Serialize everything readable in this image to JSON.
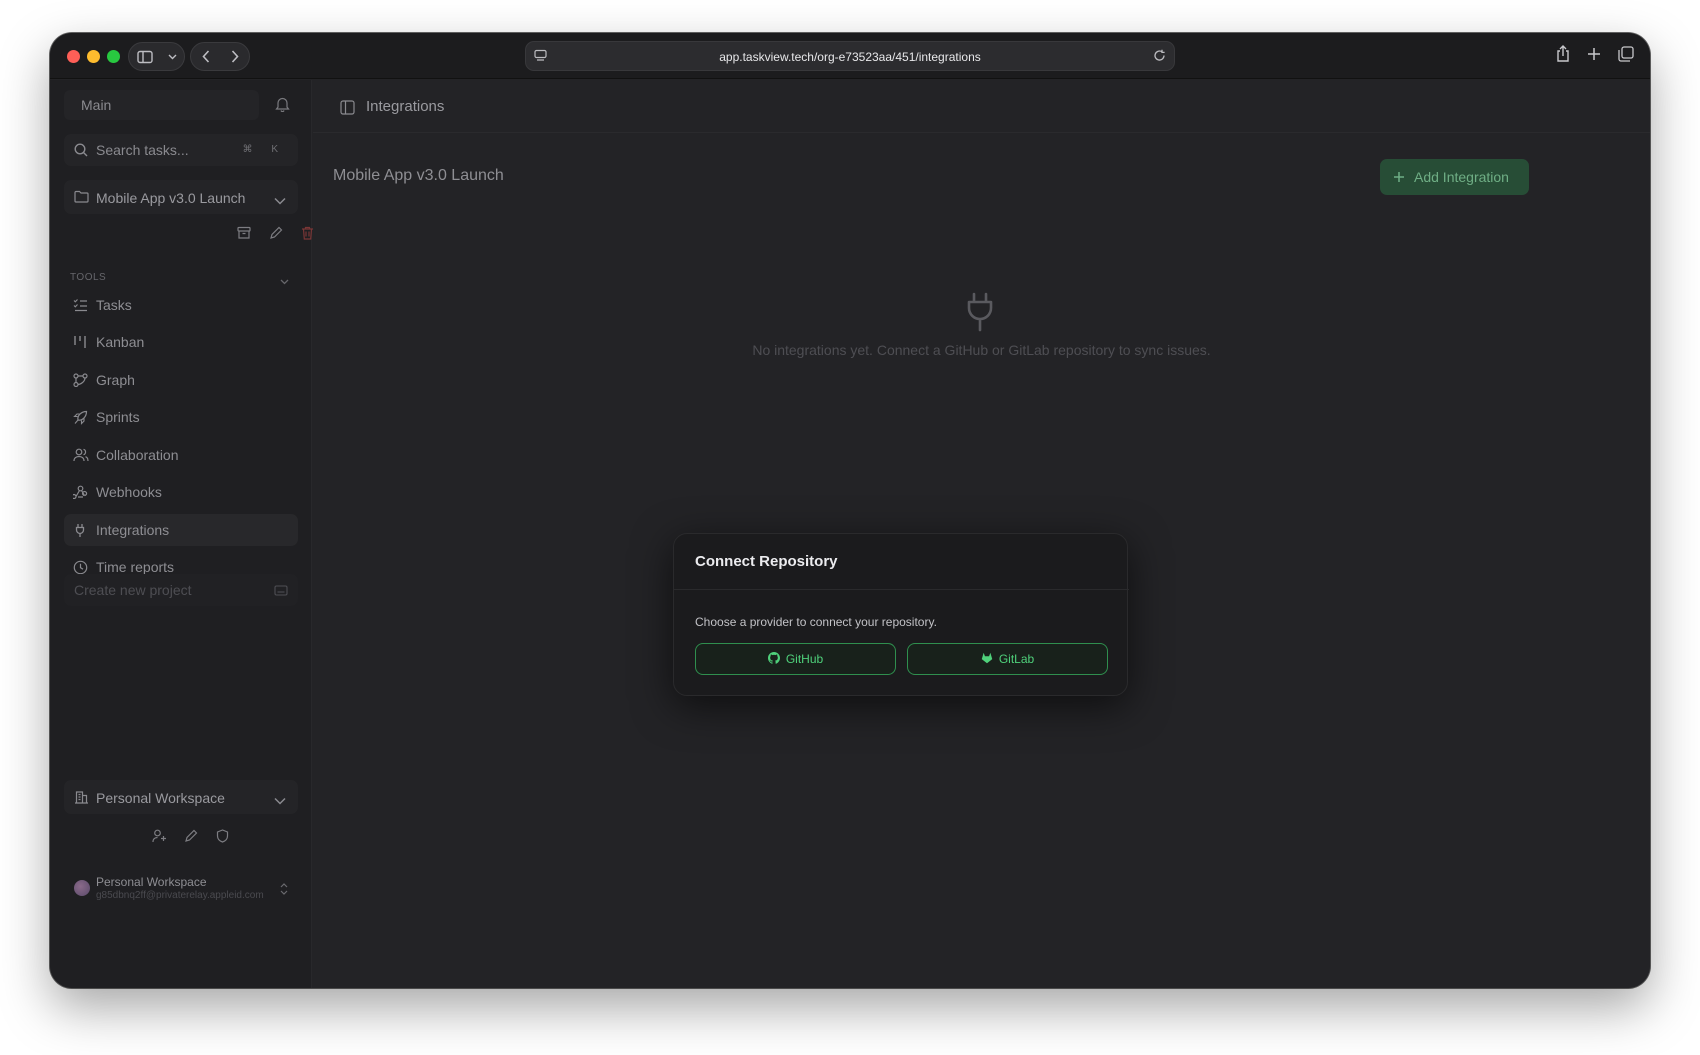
{
  "browser": {
    "url": "app.taskview.tech/org-e73523aa/451/integrations"
  },
  "sidebar": {
    "main_input": "Main",
    "search": {
      "placeholder": "Search tasks...",
      "shortcut": "⌘ K"
    },
    "project": "Mobile App v3.0 Launch",
    "tools_label": "TOOLS",
    "nav": [
      {
        "label": "Tasks",
        "icon": "tasks-icon"
      },
      {
        "label": "Kanban",
        "icon": "kanban-icon"
      },
      {
        "label": "Graph",
        "icon": "graph-icon"
      },
      {
        "label": "Sprints",
        "icon": "rocket-icon"
      },
      {
        "label": "Collaboration",
        "icon": "users-icon"
      },
      {
        "label": "Webhooks",
        "icon": "webhook-icon"
      },
      {
        "label": "Integrations",
        "icon": "plug-icon",
        "active": true
      },
      {
        "label": "Time reports",
        "icon": "clock-icon"
      }
    ],
    "create_project": "Create new project",
    "workspace": "Personal Workspace",
    "user": {
      "name": "Personal Workspace",
      "email": "g85dbnq2ff@privaterelay.appleid.com"
    }
  },
  "main": {
    "header_title": "Integrations",
    "project_title": "Mobile App v3.0 Launch",
    "add_button": "Add Integration",
    "empty_text": "No integrations yet. Connect a GitHub or GitLab repository to sync issues."
  },
  "modal": {
    "title": "Connect Repository",
    "description": "Choose a provider to connect your repository.",
    "github_label": "GitHub",
    "gitlab_label": "GitLab"
  },
  "colors": {
    "accent": "#4fd17b",
    "accent_dark": "#274d36",
    "background": "#232326",
    "sidebar": "#1f1f22"
  }
}
